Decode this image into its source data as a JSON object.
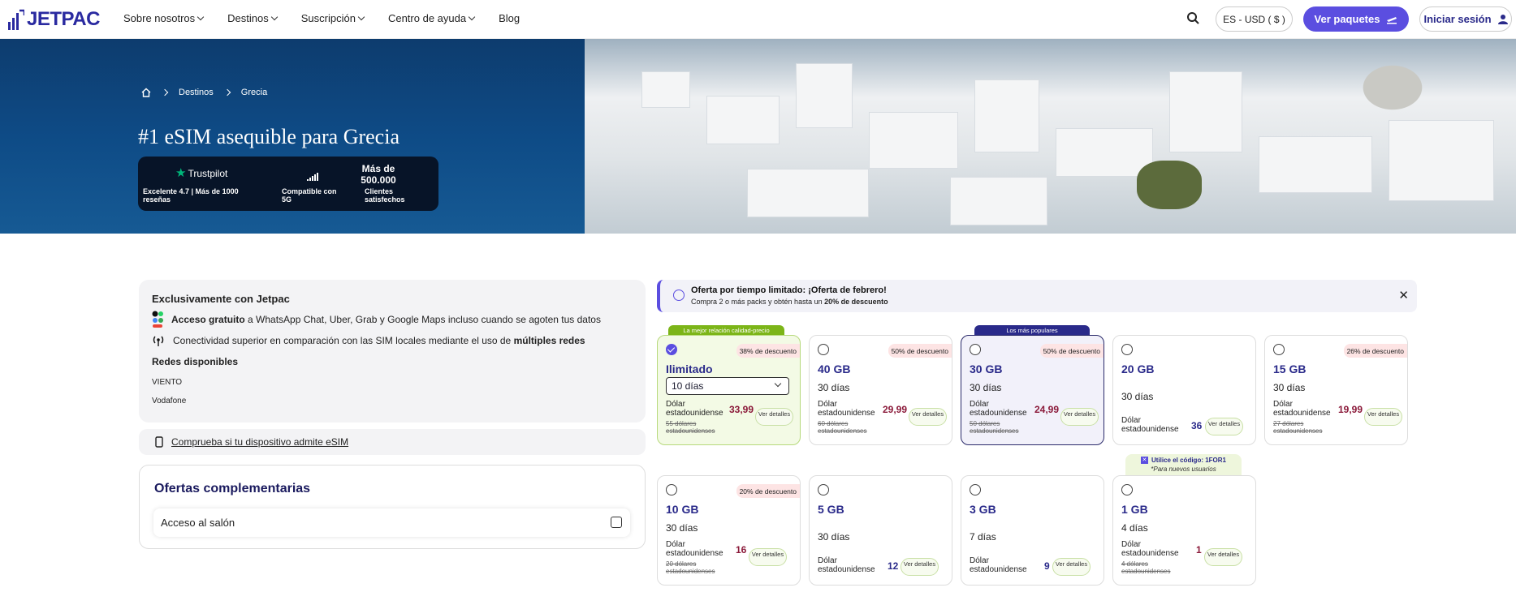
{
  "header": {
    "logo": "JETPAC",
    "nav": [
      "Sobre nosotros",
      "Destinos",
      "Suscripción",
      "Centro de ayuda",
      "Blog"
    ],
    "language": "ES - USD ( $ )",
    "cta": "Ver paquetes",
    "login": "Iniciar sesión"
  },
  "hero": {
    "breadcrumb": [
      "Destinos",
      "Grecia"
    ],
    "title": "#1 eSIM asequible para Grecia",
    "trustpilot": "Trustpilot",
    "rating": "Excelente 4.7 | Más de 1000 reseñas",
    "network": "Compatible con 5G",
    "customers_count": "Más de 500.000",
    "customers_label": "Clientes satisfechos"
  },
  "info": {
    "title": "Exclusivamente con Jetpac",
    "free_access_bold": "Acceso gratuito",
    "free_access_rest": "a WhatsApp Chat, Uber, Grab y Google Maps incluso cuando se agoten tus datos",
    "connectivity": "Conectividad superior en comparación con las SIM locales mediante el uso de",
    "connectivity_bold": "múltiples redes",
    "networks_title": "Redes disponibles",
    "networks": [
      "VIENTO",
      "Vodafone"
    ],
    "device_check": "Comprueba si tu dispositivo admite eSIM"
  },
  "offers": {
    "title": "Ofertas complementarias",
    "lounge": "Acceso al salón"
  },
  "promo": {
    "title": "Oferta por tiempo limitado: ¡Oferta de febrero!",
    "sub_prefix": "Compra 2 o más packs y obtén hasta un",
    "sub_bold": "20% de descuento"
  },
  "plans": [
    {
      "tag": "La mejor relación calidad-precio",
      "name": "Ilimitado",
      "days": "10 días",
      "discount": "38% de descuento",
      "currency": "Dólar estadounidense",
      "price": "33,99",
      "old": "55 dólares estadounidenses",
      "details": "Ver detalles"
    },
    {
      "name": "40 GB",
      "days": "30 días",
      "discount": "50% de descuento",
      "currency": "Dólar estadounidense",
      "price": "29,99",
      "old": "60 dólares estadounidenses",
      "details": "Ver detalles"
    },
    {
      "tag": "Los más populares",
      "name": "30 GB",
      "days": "30 días",
      "discount": "50% de descuento",
      "currency": "Dólar estadounidense",
      "price": "24,99",
      "old": "50 dólares estadounidenses",
      "details": "Ver detalles"
    },
    {
      "name": "20 GB",
      "days": "30 días",
      "currency": "Dólar estadounidense",
      "price": "36",
      "details": "Ver detalles"
    },
    {
      "name": "15 GB",
      "days": "30 días",
      "discount": "26% de descuento",
      "currency": "Dólar estadounidense",
      "price": "19,99",
      "old": "27 dólares estadounidenses",
      "details": "Ver detalles"
    },
    {
      "name": "10 GB",
      "days": "30 días",
      "discount": "20% de descuento",
      "currency": "Dólar estadounidense",
      "price": "16",
      "old": "20 dólares estadounidenses",
      "details": "Ver detalles"
    },
    {
      "name": "5 GB",
      "days": "30 días",
      "currency": "Dólar estadounidense",
      "price": "12",
      "details": "Ver detalles"
    },
    {
      "name": "3 GB",
      "days": "7 días",
      "currency": "Dólar estadounidense",
      "price": "9",
      "details": "Ver detalles"
    },
    {
      "name": "1 GB",
      "days": "4 días",
      "currency": "Dólar estadounidense",
      "price": "1",
      "old": "4 dólares estadounidenses",
      "details": "Ver detalles",
      "code": "Utilice el código: 1FOR1",
      "code_note": "*Para nuevos usuarios"
    }
  ],
  "colors": {
    "brand": "#5b4ee0",
    "navy": "#2a2a8a",
    "price": "#8b1a3a",
    "discount_bg": "#fde4e4"
  }
}
